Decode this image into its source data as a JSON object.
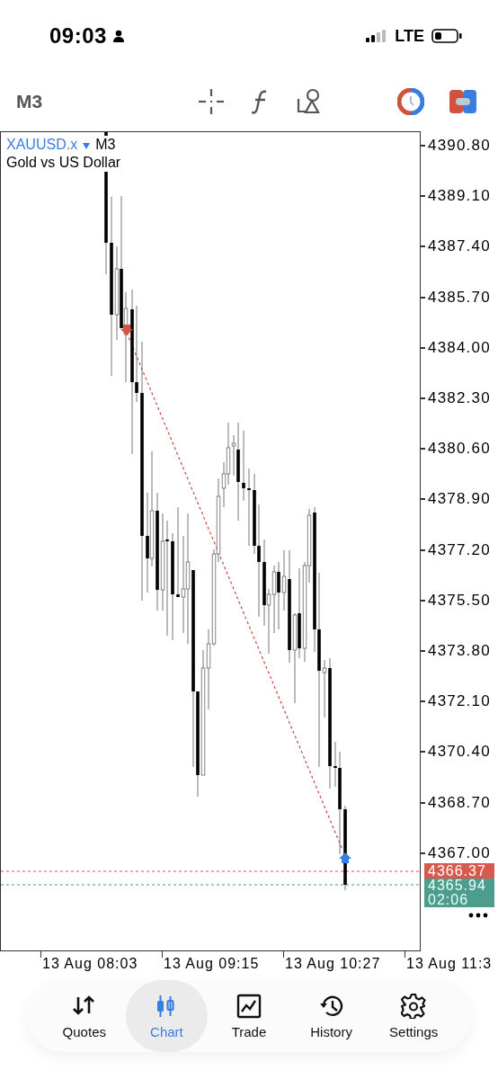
{
  "status_bar": {
    "time": "09:03",
    "network": "LTE"
  },
  "toolbar": {
    "timeframe": "M3"
  },
  "chart": {
    "symbol": "XAUUSD.x",
    "timeframe": "M3",
    "description": "Gold vs US Dollar",
    "price_ticks": [
      "4390.80",
      "4389.10",
      "4387.40",
      "4385.70",
      "4384.00",
      "4382.30",
      "4380.60",
      "4378.90",
      "4377.20",
      "4375.50",
      "4373.80",
      "4372.10",
      "4370.40",
      "4368.70",
      "4367.00"
    ],
    "bid": "4366.37",
    "ask": "4365.94",
    "countdown": "02:06",
    "time_ticks": [
      "13 Aug 08:03",
      "13 Aug 09:15",
      "13 Aug 10:27",
      "13 Aug 11:3"
    ]
  },
  "nav": [
    {
      "label": "Quotes",
      "selected": false
    },
    {
      "label": "Chart",
      "selected": true
    },
    {
      "label": "Trade",
      "selected": false
    },
    {
      "label": "History",
      "selected": false
    },
    {
      "label": "Settings",
      "selected": false
    }
  ]
}
